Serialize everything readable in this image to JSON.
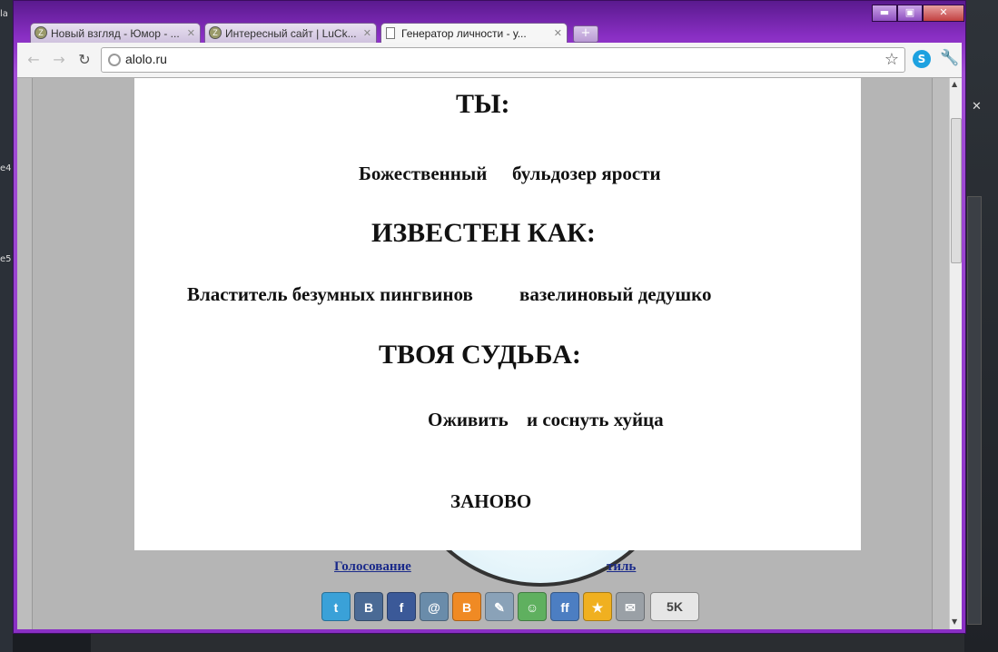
{
  "browser": {
    "tabs": [
      {
        "title": "Новый взгляд - Юмор - ..."
      },
      {
        "title": "Интересный сайт | LuCk..."
      },
      {
        "title": "Генератор личности - у..."
      }
    ],
    "address": "alolo.ru",
    "tab_close": "✕",
    "new_tab": "+"
  },
  "window_controls": {
    "minimize": "▬",
    "maximize": "▣",
    "close": "✕"
  },
  "desktop": {
    "left_labels": [
      "la",
      "e4",
      "e5"
    ]
  },
  "result": {
    "heading_you": "ТЫ:",
    "name_left": "Божественный",
    "name_right": "бульдозер ярости",
    "heading_known": "ИЗВЕСТЕН КАК:",
    "known_left": "Властитель безумных пингвинов",
    "known_right": "вазелиновый дедушко",
    "heading_fate": "ТВОЯ СУДЬБА:",
    "fate_left": "Оживить",
    "fate_right": "и соснуть хуйца",
    "again": "ЗАНОВО"
  },
  "footer": {
    "vote_left": "Голосование",
    "vote_right": "тиль",
    "share_count": "5K"
  },
  "share_icons": [
    {
      "name": "twitter-icon",
      "glyph": "t",
      "color": "#3aa1d8"
    },
    {
      "name": "vkontakte-icon",
      "glyph": "B",
      "color": "#4a6a95"
    },
    {
      "name": "facebook-icon",
      "glyph": "f",
      "color": "#3b5998"
    },
    {
      "name": "mailru-icon",
      "glyph": "@",
      "color": "#6a8caa"
    },
    {
      "name": "blogger-icon",
      "glyph": "B",
      "color": "#f08a24"
    },
    {
      "name": "livejournal-icon",
      "glyph": "✎",
      "color": "#8aa2b8"
    },
    {
      "name": "moikrug-icon",
      "glyph": "☺",
      "color": "#5fb05f"
    },
    {
      "name": "friendfeed-icon",
      "glyph": "ff",
      "color": "#4c7ec2"
    },
    {
      "name": "bookmarks-star-icon",
      "glyph": "★",
      "color": "#f0b020"
    },
    {
      "name": "email-icon",
      "glyph": "✉",
      "color": "#9aa0a6"
    }
  ]
}
